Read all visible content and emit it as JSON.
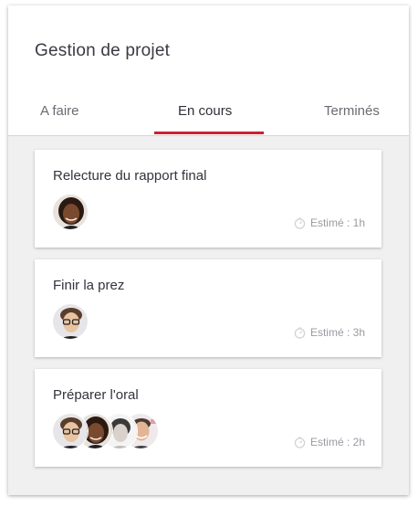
{
  "header": {
    "title": "Gestion de projet"
  },
  "tabs": [
    {
      "label": "A faire",
      "active": false
    },
    {
      "label": "En cours",
      "active": true
    },
    {
      "label": "Terminés",
      "active": false
    }
  ],
  "accent_color": "#cc1f36",
  "cards": [
    {
      "title": "Relecture du rapport final",
      "estimate": "Estimé : 1h",
      "avatars": [
        "avatar-woman-1"
      ]
    },
    {
      "title": "Finir la prez",
      "estimate": "Estimé : 3h",
      "avatars": [
        "avatar-man-glasses"
      ]
    },
    {
      "title": "Préparer l'oral",
      "estimate": "Estimé : 2h",
      "avatars": [
        "avatar-man-glasses",
        "avatar-woman-1",
        "avatar-woman-2",
        "avatar-man-2"
      ]
    }
  ]
}
